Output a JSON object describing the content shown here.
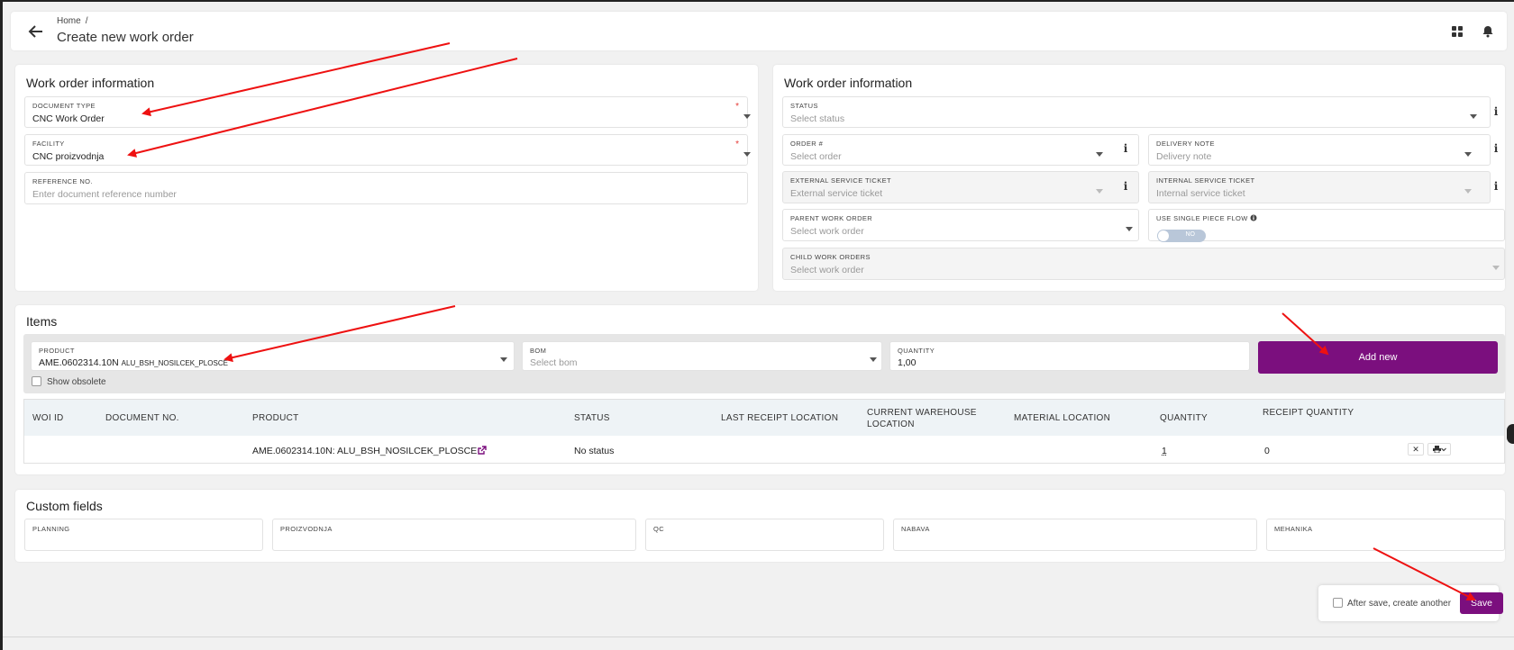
{
  "header": {
    "breadcrumb_home": "Home",
    "breadcrumb_sep": "/",
    "title": "Create new work order"
  },
  "left_panel": {
    "title": "Work order information",
    "document_type": {
      "label": "DOCUMENT TYPE",
      "value": "CNC Work Order"
    },
    "facility": {
      "label": "FACILITY",
      "value": "CNC proizvodnja"
    },
    "reference_no": {
      "label": "REFERENCE NO.",
      "placeholder": "Enter document reference number"
    }
  },
  "right_panel": {
    "title": "Work order information",
    "status": {
      "label": "STATUS",
      "placeholder": "Select status"
    },
    "order": {
      "label": "ORDER #",
      "placeholder": "Select order"
    },
    "delivery_note": {
      "label": "DELIVERY NOTE",
      "placeholder": "Delivery note"
    },
    "external_ticket": {
      "label": "EXTERNAL SERVICE TICKET",
      "placeholder": "External service ticket"
    },
    "internal_ticket": {
      "label": "INTERNAL SERVICE TICKET",
      "placeholder": "Internal service ticket"
    },
    "parent_wo": {
      "label": "PARENT WORK ORDER",
      "placeholder": "Select work order"
    },
    "single_piece": {
      "label": "USE SINGLE PIECE FLOW",
      "toggle": "NO"
    },
    "child_wo": {
      "label": "CHILD WORK ORDERS",
      "placeholder": "Select work order"
    }
  },
  "items": {
    "title": "Items",
    "product": {
      "label": "PRODUCT",
      "value_code": "AME.0602314.10N",
      "value_name": "ALU_BSH_NOSILCEK_PLOSCE"
    },
    "bom": {
      "label": "BOM",
      "placeholder": "Select bom"
    },
    "quantity": {
      "label": "QUANTITY",
      "value": "1,00"
    },
    "add_label": "Add new",
    "show_obsolete": "Show obsolete",
    "columns": [
      "WOI ID",
      "DOCUMENT NO.",
      "PRODUCT",
      "STATUS",
      "LAST RECEIPT LOCATION",
      "CURRENT WAREHOUSE LOCATION",
      "MATERIAL LOCATION",
      "QUANTITY",
      "RECEIPT QUANTITY"
    ],
    "rows": [
      {
        "woi_id": "",
        "document_no": "",
        "product": "AME.0602314.10N: ALU_BSH_NOSILCEK_PLOSCE",
        "status": "No status",
        "quantity": "1",
        "receipt_quantity": "0"
      }
    ]
  },
  "custom_fields": {
    "title": "Custom fields",
    "fields": [
      "PLANNING",
      "PROIZVODNJA",
      "QC",
      "NABAVA",
      "MEHANIKA"
    ]
  },
  "save_bar": {
    "after_save_label": "After save, create another",
    "save_label": "Save"
  },
  "colors": {
    "accent": "#7b0f7e",
    "annotation_arrow": "#ee1111"
  }
}
